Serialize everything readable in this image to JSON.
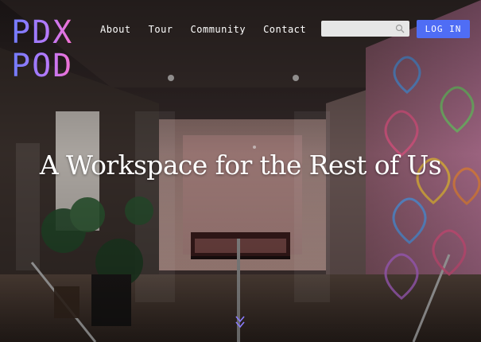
{
  "logo": {
    "line1": "PDX",
    "line2": "POD"
  },
  "nav": {
    "items": [
      "About",
      "Tour",
      "Community",
      "Contact"
    ]
  },
  "search": {
    "value": "",
    "placeholder": "",
    "icon": "search-icon"
  },
  "auth": {
    "login_label": "LOG IN"
  },
  "hero": {
    "headline": "A Workspace for the Rest of Us",
    "scroll_icon": "double-chevron-down-icon"
  },
  "colors": {
    "accent": "#4f6df5",
    "logo_gradient": [
      "#6f7cff",
      "#b57aff",
      "#ff6fc8"
    ],
    "nav_text": "#ffffff"
  }
}
